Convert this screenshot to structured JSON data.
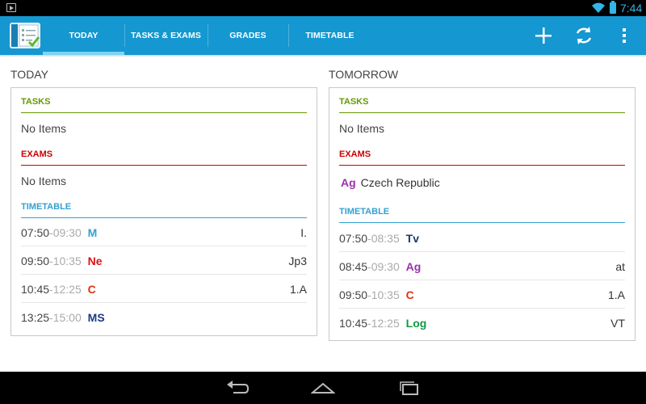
{
  "status_bar": {
    "time": "7:44"
  },
  "action_bar": {
    "tabs": [
      {
        "label": "TODAY",
        "selected": true
      },
      {
        "label": "TASKS & EXAMS",
        "selected": false
      },
      {
        "label": "GRADES",
        "selected": false
      },
      {
        "label": "TIMETABLE",
        "selected": false
      }
    ],
    "actions": [
      "add-icon",
      "refresh-icon",
      "overflow-menu-icon"
    ]
  },
  "colors": {
    "action_bar": "#1597d1",
    "tasks": "#669900",
    "exams": "#cc0000",
    "timetable": "#33a0d0"
  },
  "today": {
    "title": "TODAY",
    "tasks": {
      "header": "TASKS",
      "empty": "No Items"
    },
    "exams": {
      "header": "EXAMS",
      "empty": "No Items"
    },
    "timetable": {
      "header": "TIMETABLE",
      "rows": [
        {
          "start": "07:50",
          "end": "09:30",
          "subject": "M",
          "color": "#33a0d0",
          "room": "I."
        },
        {
          "start": "09:50",
          "end": "10:35",
          "subject": "Ne",
          "color": "#dd1111",
          "room": "Jp3"
        },
        {
          "start": "10:45",
          "end": "12:25",
          "subject": "C",
          "color": "#dd3311",
          "room": "1.A"
        },
        {
          "start": "13:25",
          "end": "15:00",
          "subject": "MS",
          "color": "#1a3a8a",
          "room": ""
        }
      ]
    }
  },
  "tomorrow": {
    "title": "TOMORROW",
    "tasks": {
      "header": "TASKS",
      "empty": "No Items"
    },
    "exams": {
      "header": "EXAMS",
      "items": [
        {
          "subject": "Ag",
          "color": "#9933aa",
          "text": "Czech Republic"
        }
      ]
    },
    "timetable": {
      "header": "TIMETABLE",
      "rows": [
        {
          "start": "07:50",
          "end": "08:35",
          "subject": "Tv",
          "color": "#1a3a6a",
          "room": ""
        },
        {
          "start": "08:45",
          "end": "09:30",
          "subject": "Ag",
          "color": "#9933aa",
          "room": "at"
        },
        {
          "start": "09:50",
          "end": "10:35",
          "subject": "C",
          "color": "#dd3311",
          "room": "1.A"
        },
        {
          "start": "10:45",
          "end": "12:25",
          "subject": "Log",
          "color": "#119944",
          "room": "VT"
        }
      ]
    }
  }
}
